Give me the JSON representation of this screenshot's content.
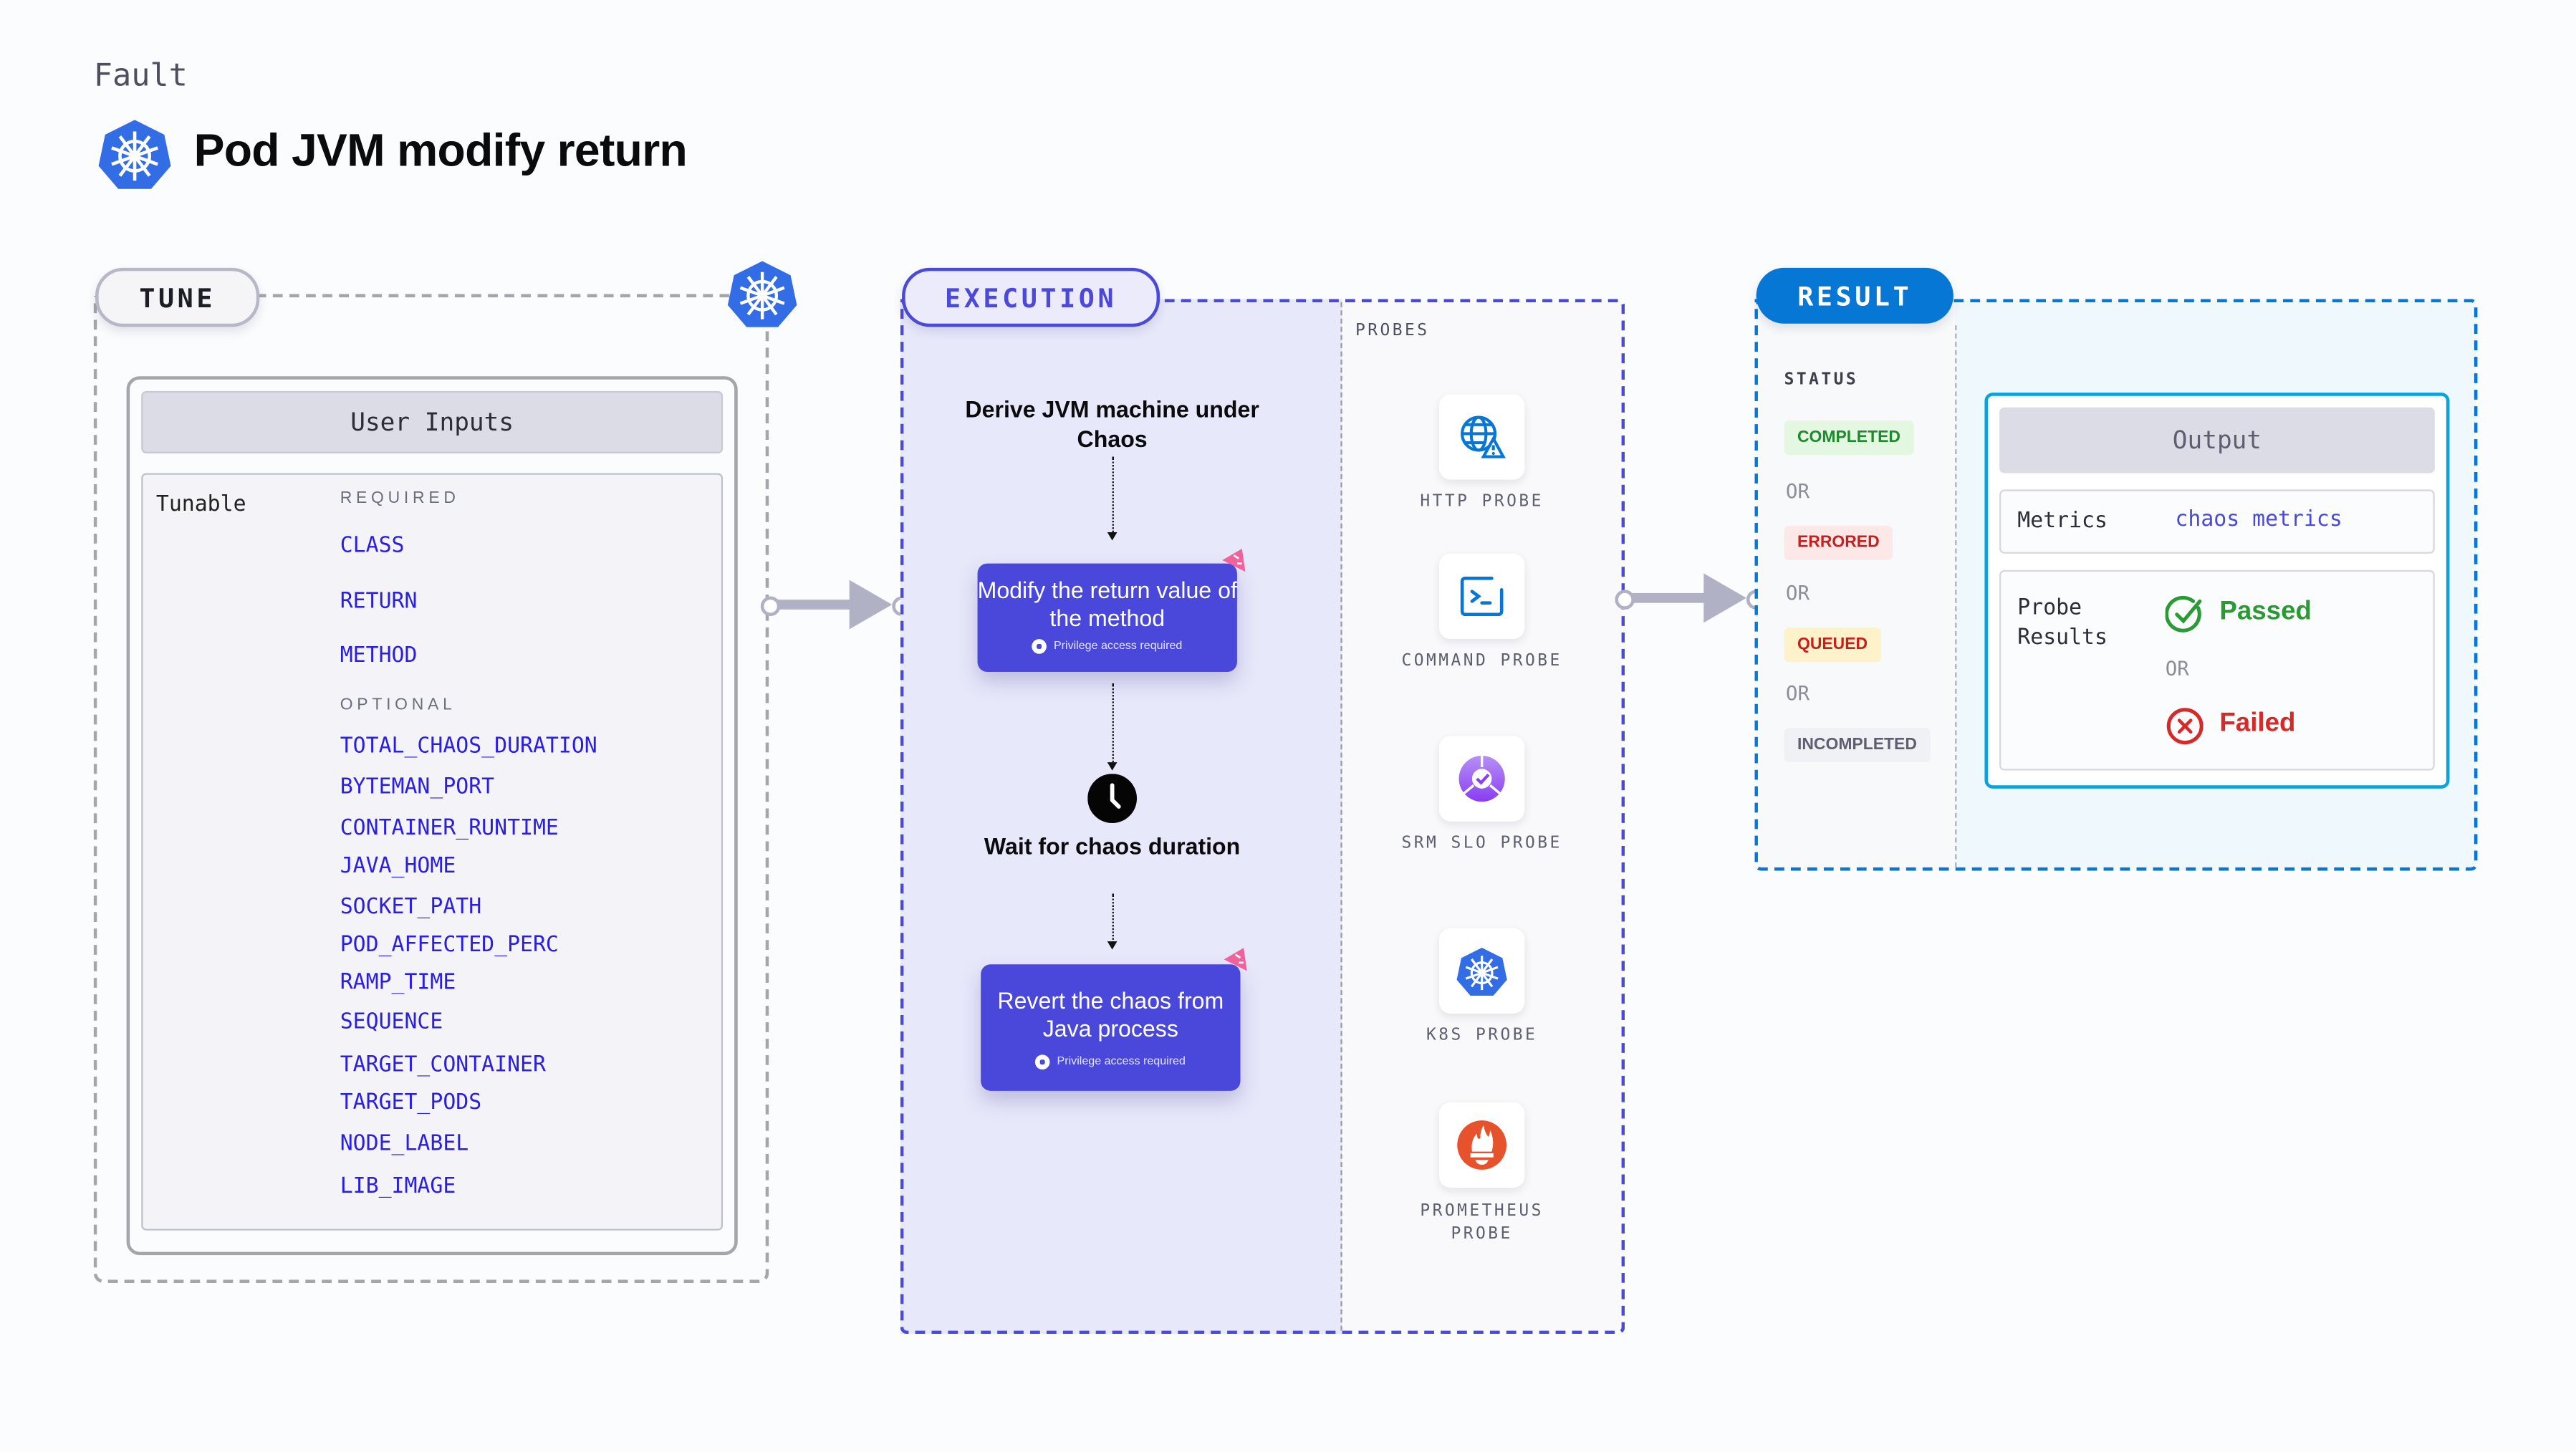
{
  "header": {
    "kind_label": "Fault",
    "title": "Pod JVM modify return",
    "icon": "kubernetes-icon"
  },
  "tune": {
    "pill_label": "TUNE",
    "icon": "kubernetes-icon",
    "card_title": "User Inputs",
    "tunable_label": "Tunable",
    "required_label": "REQUIRED",
    "required": [
      "CLASS",
      "RETURN",
      "METHOD"
    ],
    "optional_label": "OPTIONAL",
    "optional": [
      "TOTAL_CHAOS_DURATION",
      "BYTEMAN_PORT",
      "CONTAINER_RUNTIME",
      "JAVA_HOME",
      "SOCKET_PATH",
      "POD_AFFECTED_PERC",
      "RAMP_TIME",
      "SEQUENCE",
      "TARGET_CONTAINER",
      "TARGET_PODS",
      "NODE_LABEL",
      "LIB_IMAGE"
    ]
  },
  "execution": {
    "pill_label": "EXECUTION",
    "steps": [
      {
        "text": "Derive JVM machine under Chaos",
        "type": "text"
      },
      {
        "text": "Modify the return value of the method",
        "type": "card",
        "note": "Privilege access required"
      },
      {
        "text": "Wait for chaos duration",
        "type": "wait",
        "icon": "clock-icon"
      },
      {
        "text": "Revert the chaos from Java process",
        "type": "card",
        "note": "Privilege access required"
      }
    ],
    "probes_label": "PROBES",
    "probes": [
      {
        "label": "HTTP PROBE",
        "icon": "globe-warning-icon"
      },
      {
        "label": "COMMAND PROBE",
        "icon": "terminal-icon"
      },
      {
        "label": "SRM SLO PROBE",
        "icon": "slo-icon"
      },
      {
        "label": "K8S PROBE",
        "icon": "kubernetes-icon"
      },
      {
        "label": "PROMETHEUS PROBE",
        "icon": "prometheus-icon"
      }
    ]
  },
  "result": {
    "pill_label": "RESULT",
    "status_label": "STATUS",
    "statuses": [
      {
        "label": "COMPLETED",
        "color": "#1e8a2e",
        "bg": "#e4f7e1"
      },
      {
        "label": "ERRORED",
        "color": "#c81e1e",
        "bg": "#fde8e8"
      },
      {
        "label": "QUEUED",
        "color": "#c81e1e",
        "bg": "#fdf2c9"
      },
      {
        "label": "INCOMPLETED",
        "color": "#5d5f70",
        "bg": "#f0f1f5"
      }
    ],
    "or_label": "OR",
    "output": {
      "title": "Output",
      "metrics_label": "Metrics",
      "metrics_value": "chaos metrics",
      "probe_results_label_1": "Probe",
      "probe_results_label_2": "Results",
      "passed": "Passed",
      "failed": "Failed",
      "or_label": "OR"
    }
  },
  "colors": {
    "execution_accent": "#4b4ad8",
    "result_accent": "#0677d4",
    "param_text": "#2a1fe0",
    "passed": "#2a9a33",
    "failed": "#d42a2a"
  }
}
